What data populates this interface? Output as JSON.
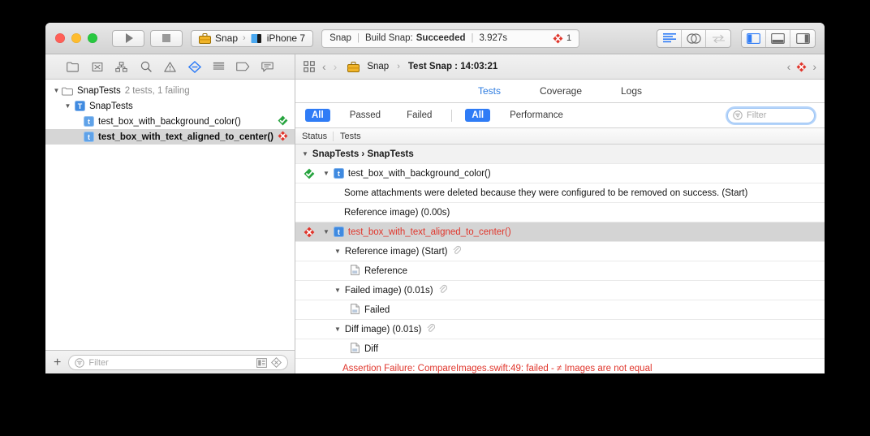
{
  "window": {
    "traffic_lights": [
      "close",
      "minimize",
      "zoom"
    ]
  },
  "toolbar": {
    "run_label": "Run",
    "stop_label": "Stop",
    "scheme_name": "Snap",
    "scheme_separator": "›",
    "destination": "iPhone 7",
    "status": {
      "project": "Snap",
      "action": "Build Snap:",
      "result": "Succeeded",
      "duration": "3.927s",
      "error_count": "1"
    },
    "editor_modes": [
      "standard-editor",
      "assistant-editor",
      "version-editor"
    ],
    "view_toggles": [
      "navigator-pane",
      "debug-pane",
      "utilities-pane"
    ]
  },
  "navigator": {
    "toolbar_icons": [
      "project-navigator-icon",
      "symbol-navigator-icon",
      "find-hierarchy-icon",
      "search-navigator-icon",
      "issue-navigator-icon",
      "test-navigator-icon",
      "debug-navigator-icon",
      "breakpoint-navigator-icon",
      "report-navigator-icon"
    ],
    "tree": [
      {
        "label": "SnapTests",
        "detail": "2 tests, 1 failing",
        "indent": 0,
        "icon": "folder",
        "status": "none",
        "selected": false
      },
      {
        "label": "SnapTests",
        "detail": "",
        "indent": 1,
        "icon": "class",
        "status": "none",
        "selected": false
      },
      {
        "label": "test_box_with_background_color()",
        "detail": "",
        "indent": 2,
        "icon": "test",
        "status": "pass",
        "selected": false
      },
      {
        "label": "test_box_with_text_aligned_to_center()",
        "detail": "",
        "indent": 2,
        "icon": "test",
        "status": "fail",
        "selected": true
      }
    ],
    "bottom": {
      "add_label": "+",
      "filter_placeholder": "Filter",
      "trailing_icons": [
        "show-only-recent-icon",
        "show-only-failed-icon"
      ]
    }
  },
  "editor": {
    "jumpbar": {
      "back": "‹",
      "forward": "›",
      "crumb_project": "Snap",
      "crumb_separator": "›",
      "crumb_report": "Test Snap : 14:03:21",
      "issue_prev": "‹",
      "issue_next": "›"
    },
    "tabs": [
      {
        "label": "Tests",
        "active": true
      },
      {
        "label": "Coverage",
        "active": false
      },
      {
        "label": "Logs",
        "active": false
      }
    ],
    "filters": {
      "group_one": [
        {
          "label": "All",
          "on": true
        },
        {
          "label": "Passed",
          "on": false
        },
        {
          "label": "Failed",
          "on": false
        }
      ],
      "group_two": [
        {
          "label": "All",
          "on": true
        },
        {
          "label": "Performance",
          "on": false
        }
      ],
      "search_placeholder": "Filter"
    },
    "columns": {
      "status": "Status",
      "tests": "Tests"
    },
    "rows": [
      {
        "kind": "group",
        "text": "SnapTests › SnapTests",
        "status": "none",
        "indent": 0,
        "arrow": "▼",
        "attachment": false
      },
      {
        "kind": "test",
        "text": "test_box_with_background_color()",
        "status": "pass",
        "indent": 0,
        "arrow": "▼",
        "attachment": false,
        "badge": "t"
      },
      {
        "kind": "detail",
        "text": "Some attachments were deleted because they were configured to be removed on success. (Start)",
        "status": "none",
        "indent": 2,
        "arrow": "",
        "attachment": false
      },
      {
        "kind": "detail",
        "text": "Reference image) (0.00s)",
        "status": "none",
        "indent": 2,
        "arrow": "",
        "attachment": false
      },
      {
        "kind": "test",
        "text": "test_box_with_text_aligned_to_center()",
        "status": "fail",
        "indent": 0,
        "arrow": "▼",
        "attachment": false,
        "badge": "t",
        "selected": true
      },
      {
        "kind": "detail",
        "text": "Reference image) (Start)",
        "status": "none",
        "indent": 1,
        "arrow": "▼",
        "attachment": true
      },
      {
        "kind": "attachment",
        "text": "Reference",
        "status": "none",
        "indent": 3,
        "arrow": "",
        "attachment": false
      },
      {
        "kind": "detail",
        "text": "Failed image) (0.01s)",
        "status": "none",
        "indent": 1,
        "arrow": "▼",
        "attachment": true
      },
      {
        "kind": "attachment",
        "text": "Failed",
        "status": "none",
        "indent": 3,
        "arrow": "",
        "attachment": false
      },
      {
        "kind": "detail",
        "text": "Diff image) (0.01s)",
        "status": "none",
        "indent": 1,
        "arrow": "▼",
        "attachment": true
      },
      {
        "kind": "attachment",
        "text": "Diff",
        "status": "none",
        "indent": 3,
        "arrow": "",
        "attachment": false
      },
      {
        "kind": "assertion",
        "text": "Assertion Failure: CompareImages.swift:49: failed - ≠ Images are not equal",
        "status": "none",
        "indent": 2,
        "arrow": "",
        "attachment": false
      }
    ]
  },
  "colors": {
    "accent_blue": "#2f7cf6",
    "fail_red": "#e0352b",
    "pass_green": "#27a43f",
    "chrome_grey": "#e6e6e6"
  }
}
